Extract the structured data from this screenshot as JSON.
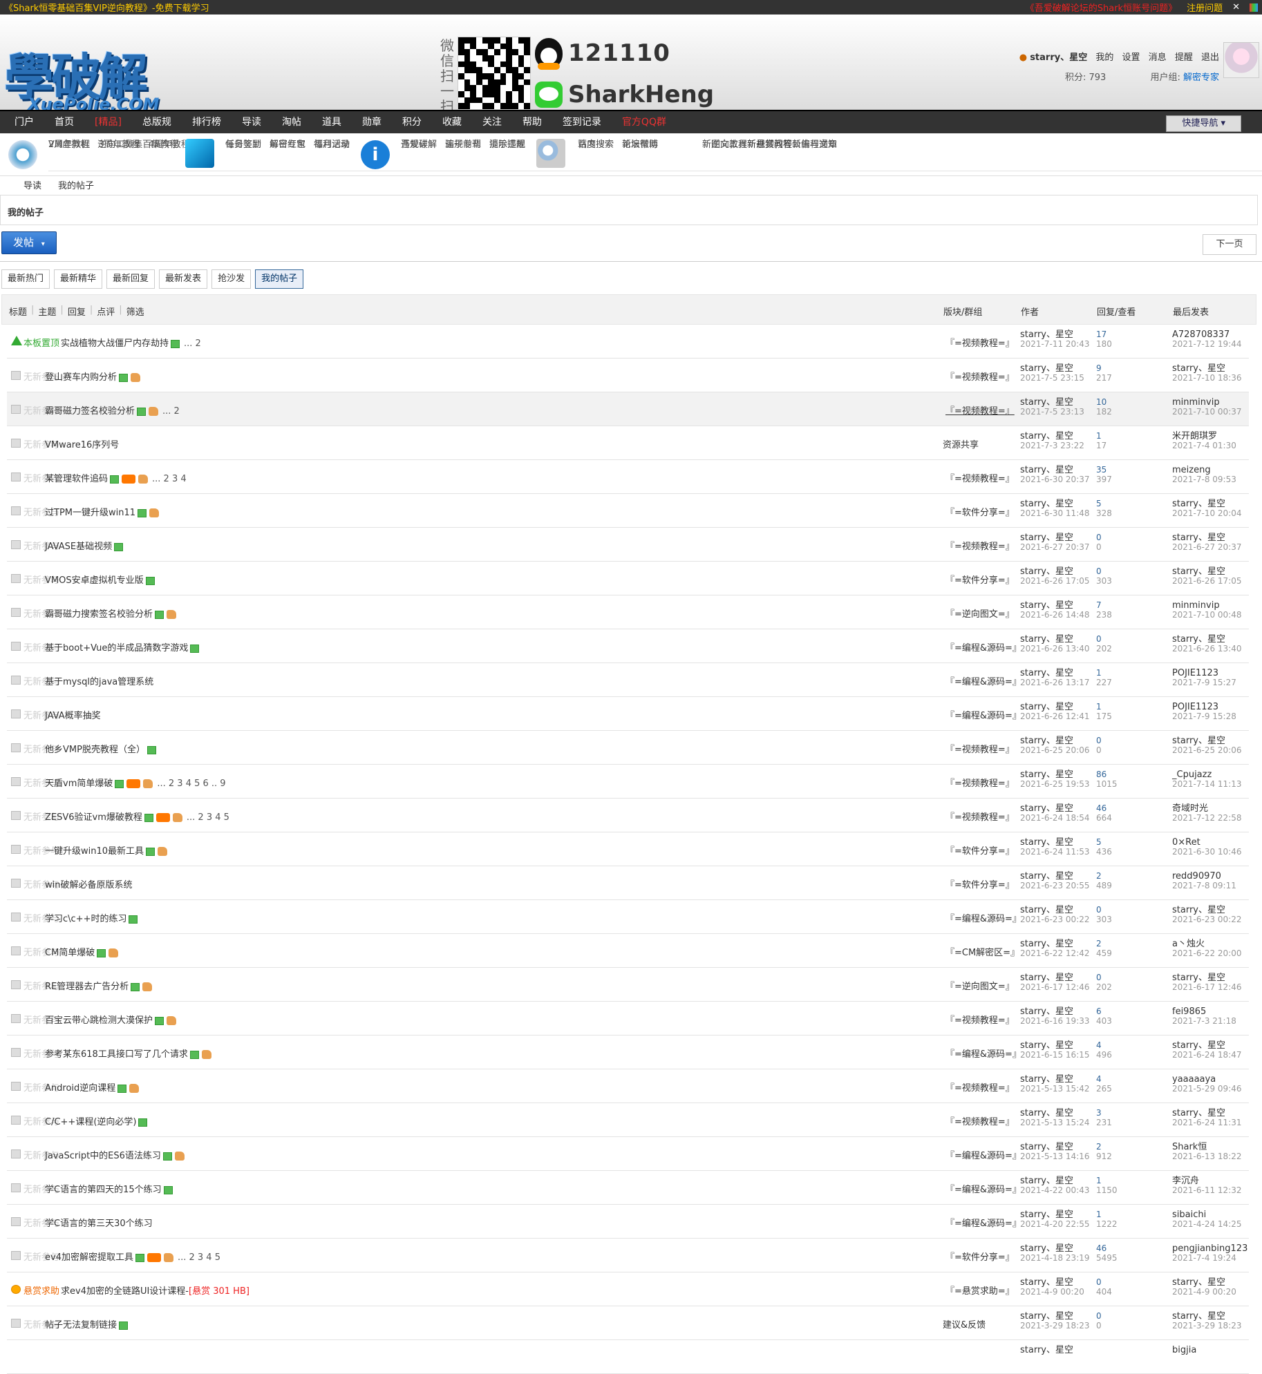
{
  "topbar": {
    "left": "《Shark恒零基础百集VIP逆向教程》-免费下载学习",
    "right_link": "《吾爱破解论坛的Shark恒账号问题》",
    "register": "注册问题"
  },
  "header": {
    "logo_text": "學破解",
    "logo_sub": "XuePoJie.COM",
    "wx_label": "微信扫一扫",
    "qq_number": "121110",
    "wechat_name": "SharkHeng",
    "user": {
      "name": "starry、星空",
      "menu": [
        "我的",
        "设置",
        "消息",
        "提醒",
        "退出"
      ],
      "points": "积分: 793",
      "group_label": "用户组:",
      "group": "解密专家"
    }
  },
  "nav": {
    "items": [
      "门户",
      "首页",
      "[精品]",
      "总版规",
      "排行榜",
      "导读",
      "淘帖",
      "道具",
      "勋章",
      "积分",
      "收藏",
      "关注",
      "帮助",
      "签到记录",
      "官方QQ群"
    ],
    "quick": "快捷导航"
  },
  "subnav": {
    "g1": {
      "r1": [
        {
          "t": "VM虚拟机",
          "c": "blue"
        },
        {
          "t": "逆向工具集",
          "c": "blue"
        },
        {
          "t": "百集教程",
          "c": "red"
        }
      ],
      "r2": [
        "2周年教程",
        "3周年教程",
        "4周年教程"
      ]
    },
    "g2": {
      "r1": [
        "每日签到",
        "每日红包",
        "每月活动"
      ],
      "r2": [
        "任务奖励",
        "解密专家",
        "福利记录"
      ]
    },
    "g3": {
      "r1": [
        "吾爱破解",
        "骗子专刊",
        "提示提醒"
      ],
      "r2": [
        "违规详解",
        "违规前辈",
        "消除违规"
      ]
    },
    "g4": {
      "r1": [
        "百度搜索",
        "论坛帮助"
      ],
      "r2": [
        "站内搜索",
        "新浪微博"
      ]
    },
    "g5": {
      "r1": [
        {
          "t": "新图文教程",
          "c": "pur"
        },
        {
          "t": "新视频教程",
          "c": "pur"
        },
        {
          "t": "公告与通知",
          "c": "red"
        }
      ],
      "r2": [
        {
          "t": "新逆向工具",
          "c": "grn"
        },
        {
          "t": "新悬赏问答",
          "c": ""
        },
        {
          "t": "新编程文章",
          "c": "red"
        }
      ]
    }
  },
  "breadcrumb": [
    "导读",
    "我的帖子"
  ],
  "page_title": "我的帖子",
  "post_button": "发帖",
  "next_button": "下一页",
  "tabs": [
    "最新热门",
    "最新精华",
    "最新回复",
    "最新发表",
    "抢沙发",
    "我的帖子"
  ],
  "table_header": {
    "filters": [
      "标题",
      "主题",
      "回复",
      "点评",
      "筛选"
    ],
    "forum": "版块/群组",
    "author": "作者",
    "stats": "回复/查看",
    "last": "最后发表"
  },
  "rows": [
    {
      "tag": "本板置顶",
      "title": "实战植物大战僵尸内存劫持",
      "pages": "... 2",
      "forum": "『=视频教程=』",
      "author": "starry、星空",
      "date": "2021-7-11 20:43",
      "replies": "17",
      "views": "180",
      "last_user": "A728708337",
      "last_date": "2021-7-12 19:44"
    },
    {
      "tag": "无新参与",
      "title": "登山赛车内购分析",
      "pages": "",
      "forum": "『=视频教程=』",
      "author": "starry、星空",
      "date": "2021-7-5 23:15",
      "replies": "9",
      "views": "217",
      "last_user": "starry、星空",
      "last_date": "2021-7-10 18:36"
    },
    {
      "tag": "无新参与",
      "title": "霸哥磁力签名校验分析",
      "pages": "... 2",
      "forum": "『=视频教程=』",
      "author": "starry、星空",
      "date": "2021-7-5 23:13",
      "replies": "10",
      "views": "182",
      "last_user": "minminvip",
      "last_date": "2021-7-10 00:37"
    },
    {
      "tag": "无新参与",
      "title": "VMware16序列号",
      "pages": "",
      "forum": "资源共享",
      "author": "starry、星空",
      "date": "2021-7-3 23:22",
      "replies": "1",
      "views": "17",
      "last_user": "米开朗琪罗",
      "last_date": "2021-7-4 01:30"
    },
    {
      "tag": "无新参与",
      "title": "某管理软件追码",
      "pages": "... 2 3 4",
      "forum": "『=视频教程=』",
      "author": "starry、星空",
      "date": "2021-6-30 20:37",
      "replies": "35",
      "views": "397",
      "last_user": "meizeng",
      "last_date": "2021-7-8 09:53"
    },
    {
      "tag": "无新参与",
      "title": "过TPM一键升级win11",
      "pages": "",
      "forum": "『=软件分享=』",
      "author": "starry、星空",
      "date": "2021-6-30 11:48",
      "replies": "5",
      "views": "328",
      "last_user": "starry、星空",
      "last_date": "2021-7-10 20:04"
    },
    {
      "tag": "无新参与",
      "title": "JAVASE基础视频",
      "pages": "",
      "forum": "『=视频教程=』",
      "author": "starry、星空",
      "date": "2021-6-27 20:37",
      "replies": "0",
      "views": "0",
      "last_user": "starry、星空",
      "last_date": "2021-6-27 20:37"
    },
    {
      "tag": "无新参与",
      "title": "VMOS安卓虚拟机专业版",
      "pages": "",
      "forum": "『=软件分享=』",
      "author": "starry、星空",
      "date": "2021-6-26 17:05",
      "replies": "0",
      "views": "303",
      "last_user": "starry、星空",
      "last_date": "2021-6-26 17:05"
    },
    {
      "tag": "无新参与",
      "title": "霸哥磁力搜索签名校验分析",
      "pages": "",
      "forum": "『=逆向图文=』",
      "author": "starry、星空",
      "date": "2021-6-26 14:48",
      "replies": "7",
      "views": "238",
      "last_user": "minminvip",
      "last_date": "2021-7-10 00:48"
    },
    {
      "tag": "无新参与",
      "title": "基于boot+Vue的半成品猜数字游戏",
      "pages": "",
      "forum": "『=编程&源码=』",
      "author": "starry、星空",
      "date": "2021-6-26 13:40",
      "replies": "0",
      "views": "202",
      "last_user": "starry、星空",
      "last_date": "2021-6-26 13:40"
    },
    {
      "tag": "无新参与",
      "title": "基于mysql的java管理系统",
      "pages": "",
      "forum": "『=编程&源码=』",
      "author": "starry、星空",
      "date": "2021-6-26 13:17",
      "replies": "1",
      "views": "227",
      "last_user": "POJIE1123",
      "last_date": "2021-7-9 15:27"
    },
    {
      "tag": "无新参与",
      "title": "JAVA概率抽奖",
      "pages": "",
      "forum": "『=编程&源码=』",
      "author": "starry、星空",
      "date": "2021-6-26 12:41",
      "replies": "1",
      "views": "175",
      "last_user": "POJIE1123",
      "last_date": "2021-7-9 15:28"
    },
    {
      "tag": "无新参与",
      "title": "他乡VMP脱壳教程（全）",
      "pages": "",
      "forum": "『=视频教程=』",
      "author": "starry、星空",
      "date": "2021-6-25 20:06",
      "replies": "0",
      "views": "0",
      "last_user": "starry、星空",
      "last_date": "2021-6-25 20:06"
    },
    {
      "tag": "无新参与",
      "title": "天盾vm简单爆破",
      "pages": "... 2 3 4 5 6 .. 9",
      "forum": "『=视频教程=』",
      "author": "starry、星空",
      "date": "2021-6-25 19:53",
      "replies": "86",
      "views": "1015",
      "last_user": "_Cpujazz",
      "last_date": "2021-7-14 11:13"
    },
    {
      "tag": "无新参与",
      "title": "ZESV6验证vm爆破教程",
      "pages": "... 2 3 4 5",
      "forum": "『=视频教程=』",
      "author": "starry、星空",
      "date": "2021-6-24 18:54",
      "replies": "46",
      "views": "664",
      "last_user": "奇域时光",
      "last_date": "2021-7-12 22:58"
    },
    {
      "tag": "无新参与",
      "title": "一键升级win10最新工具",
      "pages": "",
      "forum": "『=软件分享=』",
      "author": "starry、星空",
      "date": "2021-6-24 11:53",
      "replies": "5",
      "views": "436",
      "last_user": "0×Ret",
      "last_date": "2021-6-30 10:46"
    },
    {
      "tag": "无新参与",
      "title": "win破解必备原版系统",
      "pages": "",
      "forum": "『=软件分享=』",
      "author": "starry、星空",
      "date": "2021-6-23 20:55",
      "replies": "2",
      "views": "489",
      "last_user": "redd90970",
      "last_date": "2021-7-8 09:11"
    },
    {
      "tag": "无新参与",
      "title": "学习c\\c++时的练习",
      "pages": "",
      "forum": "『=编程&源码=』",
      "author": "starry、星空",
      "date": "2021-6-23 00:22",
      "replies": "0",
      "views": "303",
      "last_user": "starry、星空",
      "last_date": "2021-6-23 00:22"
    },
    {
      "tag": "无新参与",
      "title": "CM简单爆破",
      "pages": "",
      "forum": "『=CM解密区=』",
      "author": "starry、星空",
      "date": "2021-6-22 12:42",
      "replies": "2",
      "views": "459",
      "last_user": "a丶烛火",
      "last_date": "2021-6-22 20:00"
    },
    {
      "tag": "无新参与",
      "title": "RE管理器去广告分析",
      "pages": "",
      "forum": "『=逆向图文=』",
      "author": "starry、星空",
      "date": "2021-6-17 12:46",
      "replies": "0",
      "views": "202",
      "last_user": "starry、星空",
      "last_date": "2021-6-17 12:46"
    },
    {
      "tag": "无新参与",
      "title": "百宝云带心跳检测大漠保护",
      "pages": "",
      "forum": "『=视频教程=』",
      "author": "starry、星空",
      "date": "2021-6-16 19:33",
      "replies": "6",
      "views": "403",
      "last_user": "fei9865",
      "last_date": "2021-7-3 21:18"
    },
    {
      "tag": "无新参与",
      "title": "参考某东618工具接口写了几个请求",
      "pages": "",
      "forum": "『=编程&源码=』",
      "author": "starry、星空",
      "date": "2021-6-15 16:15",
      "replies": "4",
      "views": "496",
      "last_user": "starry、星空",
      "last_date": "2021-6-24 18:47"
    },
    {
      "tag": "无新参与",
      "title": "Android逆向课程",
      "pages": "",
      "forum": "『=视频教程=』",
      "author": "starry、星空",
      "date": "2021-5-13 15:42",
      "replies": "4",
      "views": "265",
      "last_user": "yaaaaaya",
      "last_date": "2021-5-29 09:46"
    },
    {
      "tag": "无新参与",
      "title": "C/C++课程(逆向必学)",
      "pages": "",
      "forum": "『=视频教程=』",
      "author": "starry、星空",
      "date": "2021-5-13 15:24",
      "replies": "3",
      "views": "231",
      "last_user": "starry、星空",
      "last_date": "2021-6-24 11:31"
    },
    {
      "tag": "无新参与",
      "title": "JavaScript中的ES6语法练习",
      "pages": "",
      "forum": "『=编程&源码=』",
      "author": "starry、星空",
      "date": "2021-5-13 14:16",
      "replies": "2",
      "views": "912",
      "last_user": "Shark恒",
      "last_date": "2021-6-13 18:22"
    },
    {
      "tag": "无新参与",
      "title": "学C语言的第四天的15个练习",
      "pages": "",
      "forum": "『=编程&源码=』",
      "author": "starry、星空",
      "date": "2021-4-22 00:43",
      "replies": "1",
      "views": "1150",
      "last_user": "李沉舟",
      "last_date": "2021-6-11 12:32"
    },
    {
      "tag": "无新参与",
      "title": "学C语言的第三天30个练习",
      "pages": "",
      "forum": "『=编程&源码=』",
      "author": "starry、星空",
      "date": "2021-4-20 22:55",
      "replies": "1",
      "views": "1222",
      "last_user": "sibaichi",
      "last_date": "2021-4-24 14:25"
    },
    {
      "tag": "无新参与",
      "title": "ev4加密解密提取工具",
      "pages": "... 2 3 4 5",
      "forum": "『=软件分享=』",
      "author": "starry、星空",
      "date": "2021-4-18 23:19",
      "replies": "46",
      "views": "5495",
      "last_user": "pengjianbing123",
      "last_date": "2021-7-4 19:24"
    },
    {
      "tag": "悬赏求助",
      "title": "求ev4加密的全链路UI设计课程-",
      "pages": "",
      "reward": "[悬赏 301 HB]",
      "forum": "『=悬赏求助=』",
      "author": "starry、星空",
      "date": "2021-4-9 00:20",
      "replies": "0",
      "views": "404",
      "last_user": "starry、星空",
      "last_date": "2021-4-9 00:20"
    },
    {
      "tag": "无新参与",
      "title": "帖子无法复制链接",
      "pages": "",
      "forum": "建议&反馈",
      "author": "starry、星空",
      "date": "2021-3-29 18:23",
      "replies": "0",
      "views": "0",
      "last_user": "starry、星空",
      "last_date": "2021-3-29 18:23"
    },
    {
      "tag": "",
      "title": "",
      "pages": "",
      "forum": "",
      "author": "starry、星空",
      "date": "",
      "replies": "",
      "views": "",
      "last_user": "bigjia",
      "last_date": ""
    }
  ]
}
